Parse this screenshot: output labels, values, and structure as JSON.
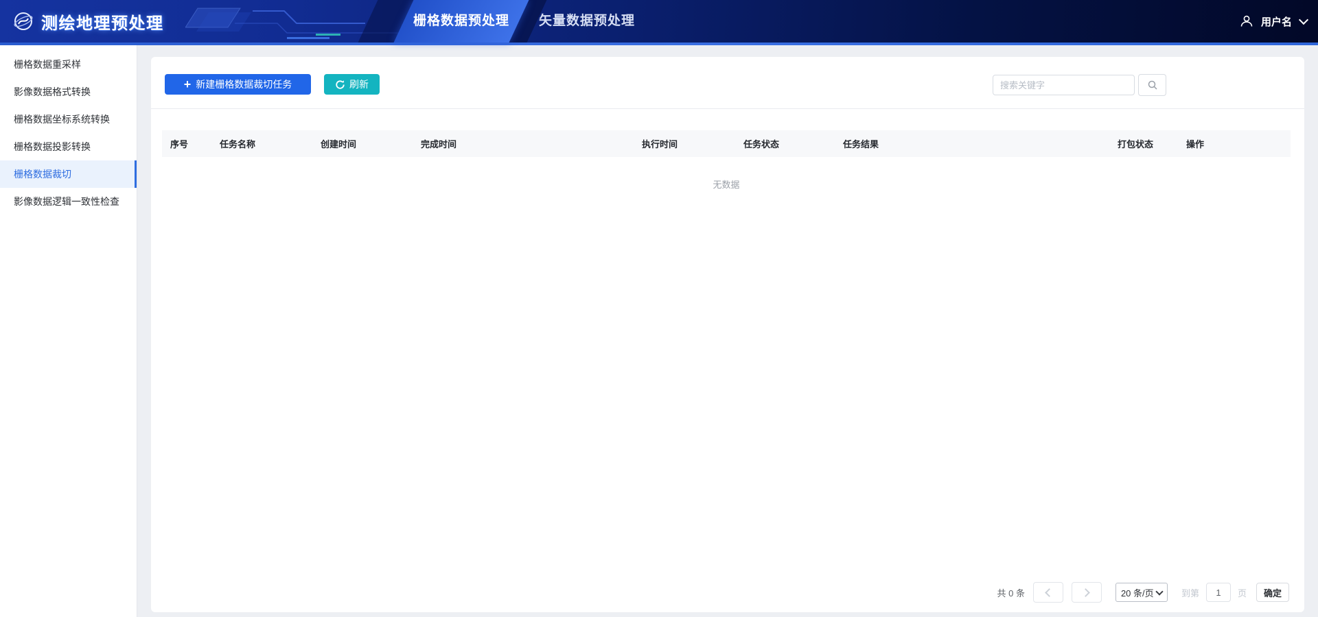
{
  "header": {
    "app_title": "测绘地理预处理",
    "tabs": [
      {
        "label": "栅格数据预处理",
        "active": true
      },
      {
        "label": "矢量数据预处理",
        "active": false
      }
    ],
    "user": {
      "name": "用户名",
      "icon": "user-icon",
      "dropdown_icon": "chevron-down-icon"
    },
    "logo_icon": "globe-orbit-logo"
  },
  "sidebar": {
    "items": [
      {
        "label": "栅格数据重采样",
        "active": false
      },
      {
        "label": "影像数据格式转换",
        "active": false
      },
      {
        "label": "栅格数据坐标系统转换",
        "active": false
      },
      {
        "label": "栅格数据投影转换",
        "active": false
      },
      {
        "label": "栅格数据裁切",
        "active": true
      },
      {
        "label": "影像数据逻辑一致性检查",
        "active": false
      }
    ]
  },
  "toolbar": {
    "new_task_label": "新建栅格数据裁切任务",
    "new_task_icon": "plus-icon",
    "refresh_label": "刷新",
    "refresh_icon": "refresh-icon",
    "search_placeholder": "搜索关键字",
    "search_icon": "search-icon"
  },
  "table": {
    "columns": [
      "序号",
      "任务名称",
      "创建时间",
      "完成时间",
      "执行时间",
      "任务状态",
      "任务结果",
      "打包状态",
      "操作"
    ],
    "rows": [],
    "empty_text": "无数据"
  },
  "pagination": {
    "total_text": "共 0 条",
    "prev_icon": "chevron-left-icon",
    "next_icon": "chevron-right-icon",
    "page_size_label": "20 条/页",
    "goto_prefix": "到第",
    "current_page": "1",
    "goto_suffix": "页",
    "confirm_label": "确定"
  },
  "colors": {
    "primary_button": "#2166e8",
    "refresh_button": "#14b4c0",
    "sidebar_active_text": "#2e6de0",
    "sidebar_active_bg": "#eaf2fd",
    "header_gradient_left": "#1533a0",
    "header_gradient_right": "#020827",
    "header_accent_line": "#3a6fe2",
    "active_tab_gradient": "#2150c9 → #3e72e9",
    "table_head_bg": "#f7f8fa",
    "main_bg": "#edeff3"
  }
}
